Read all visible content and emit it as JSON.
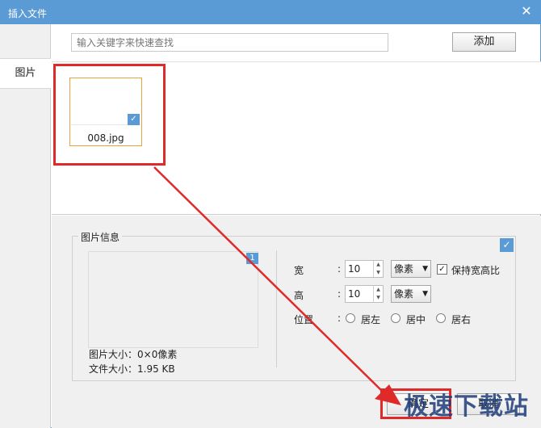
{
  "window": {
    "title": "插入文件",
    "close_icon": "close-icon"
  },
  "sidebar": {
    "items": [
      {
        "label": "图片"
      }
    ]
  },
  "toolbar": {
    "search_placeholder": "输入关键字来快速查找",
    "add_label": "添加"
  },
  "files": [
    {
      "name": "008.jpg",
      "checked": true
    }
  ],
  "image_info": {
    "title": "图片信息",
    "preview_badge": "1",
    "size_label": "图片大小：",
    "size_value": "0×0像素",
    "filesize_label": "文件大小：",
    "filesize_value": "1.95 KB",
    "width_label": "宽",
    "height_label": "高",
    "position_label": "位置",
    "colon": ":",
    "width_value": "10",
    "height_value": "10",
    "width_unit": "像素",
    "height_unit": "像素",
    "keep_ratio_label": "保持宽高比",
    "keep_ratio_checked": true,
    "align_left": "居左",
    "align_center": "居中",
    "align_right": "居右"
  },
  "footer": {
    "ok_label": "确定",
    "cancel_label": "取消"
  },
  "watermark": "极速下载站",
  "colors": {
    "titlebar": "#5b9bd5",
    "highlight": "#e02a2a",
    "thumb_border": "#e8a33d"
  }
}
